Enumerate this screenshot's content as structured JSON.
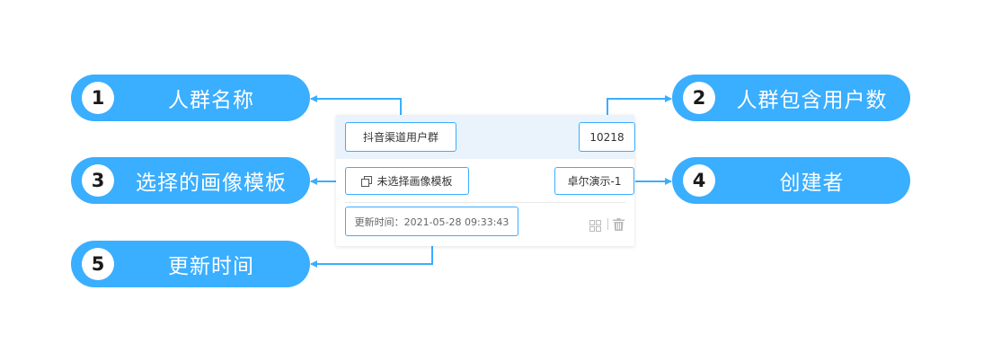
{
  "callouts": [
    {
      "number": "1",
      "label": "人群名称"
    },
    {
      "number": "2",
      "label": "人群包含用户数"
    },
    {
      "number": "3",
      "label": "选择的画像模板"
    },
    {
      "number": "4",
      "label": "创建者"
    },
    {
      "number": "5",
      "label": "更新时间"
    }
  ],
  "card": {
    "group_name": "抖音渠道用户群",
    "user_count": "10218",
    "template": "未选择画像模板",
    "creator": "卓尔演示-1",
    "updated_time": "更新时间：2021-05-28 09:33:43",
    "icons": [
      "template-copy-icon",
      "grid-icon",
      "trash-icon"
    ]
  },
  "colors": {
    "accent": "#3aaeff",
    "card_header": "#eaf3fc",
    "icon_gray": "#bbbbbb"
  }
}
